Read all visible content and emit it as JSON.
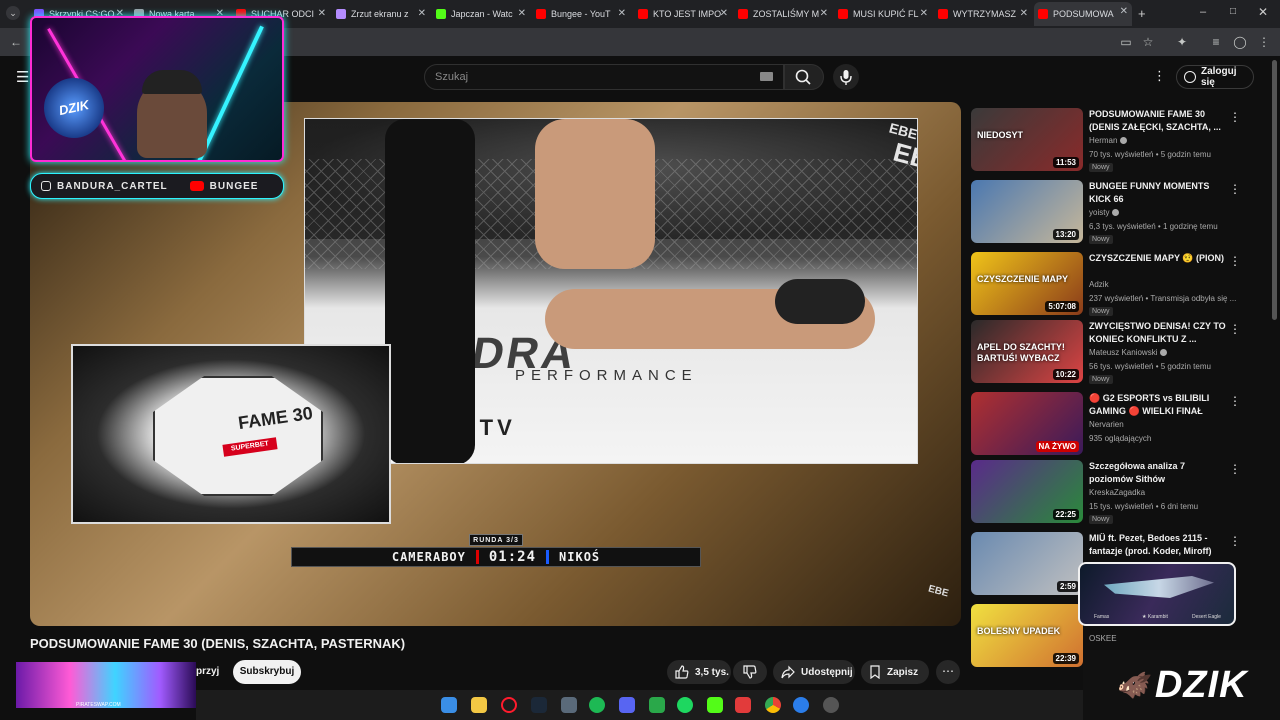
{
  "tabs": [
    {
      "label": "Skrzynki CS:GO",
      "color": "#7b4dff"
    },
    {
      "label": "Nowa karta",
      "color": "#9aa0a6"
    },
    {
      "label": "SUCHAR ODCI",
      "color": "#ff0000"
    },
    {
      "label": "Zrzut ekranu z",
      "color": "#b48cff"
    },
    {
      "label": "Japczan - Watc",
      "color": "#53fc18"
    },
    {
      "label": "Bungee - YouT",
      "color": "#ff0000"
    },
    {
      "label": "KTO JEST IMPO",
      "color": "#ff0000"
    },
    {
      "label": "ZOSTALIŚMY M",
      "color": "#ff0000"
    },
    {
      "label": "MUSI KUPIĆ FL",
      "color": "#ff0000"
    },
    {
      "label": "WYTRZYMASZ",
      "color": "#ff0000"
    },
    {
      "label": "PODSUMOWA",
      "color": "#ff0000"
    }
  ],
  "search": {
    "placeholder": "Szukaj"
  },
  "header": {
    "signin": "Zaloguj się"
  },
  "overlay": {
    "webcam_badge": "DZIK",
    "social_instagram": "BANDURA_CARTEL",
    "social_youtube": "BUNGEE"
  },
  "fight": {
    "mat_logo": "HYDRA",
    "mat_sub": "PERFORMANCE",
    "mat_url": "MMA.TV",
    "corner_logo": "EBE",
    "round": "RUNDA 3/3",
    "fighter_left": "CAMERABOY",
    "clock": "01:24",
    "fighter_right": "NIKOŚ",
    "overhead_brand": "FAME 30",
    "overhead_sponsor": "SUPERBET"
  },
  "video": {
    "title": "PODSUMOWANIE FAME 30 (DENIS, SZACHTA, PASTERNAK)",
    "channel_tail": "przyj",
    "subscribe": "Subskrybuj",
    "likes": "3,5 tys.",
    "share": "Udostępnij",
    "save": "Zapisz"
  },
  "recommendations": [
    {
      "title": "PODSUMOWANIE FAME 30 (DENIS ZAŁĘCKI, SZACHTA, ...",
      "channel": "Herman",
      "verified": true,
      "meta": "70 tys. wyświetleń • 5 godzin temu",
      "badge": "Nowy",
      "duration": "11:53",
      "thumb_text": "NIEDOSYT",
      "c1": "#3a3a3a",
      "c2": "#8a2a2a"
    },
    {
      "title": "BUNGEE FUNNY MOMENTS KICK 66",
      "channel": "yoisty",
      "verified": true,
      "meta": "6,3 tys. wyświetleń • 1 godzinę temu",
      "badge": "Nowy",
      "duration": "13:20",
      "thumb_text": "",
      "c1": "#4b78b0",
      "c2": "#c6b79a"
    },
    {
      "title": "CZYSZCZENIE MAPY 🤨 (PION)",
      "channel": "Adzik",
      "verified": false,
      "meta": "237 wyświetleń • Transmisja odbyła się ...",
      "badge": "Nowy",
      "duration": "5:07:08",
      "thumb_text": "CZYSZCZENIE MAPY",
      "c1": "#f0c419",
      "c2": "#8a3b1a"
    },
    {
      "title": "ZWYCIĘSTWO DENISA! CZY TO KONIEC KONFLIKTU Z ...",
      "channel": "Mateusz Kaniowski",
      "verified": true,
      "meta": "56 tys. wyświetleń • 5 godzin temu",
      "badge": "Nowy",
      "duration": "10:22",
      "thumb_text": "APEL DO SZACHTY! BARTUŚ! WYBACZ",
      "c1": "#2a2a2a",
      "c2": "#d44"
    },
    {
      "title": "🔴 G2 ESPORTS vs BILIBILI GAMING 🔴 WIELKI FINAŁ FIR...",
      "channel": "Nervarien",
      "verified": false,
      "meta": "935 oglądających",
      "badge": "",
      "duration": "NA ŻYWO",
      "thumb_text": "",
      "c1": "#b03030",
      "c2": "#3a1a5a"
    },
    {
      "title": "Szczegółowa analiza 7 poziomów Sithów",
      "channel": "KreskaZagadka",
      "verified": false,
      "meta": "15 tys. wyświetleń • 6 dni temu",
      "badge": "Nowy",
      "duration": "22:25",
      "thumb_text": "",
      "c1": "#5a2a8a",
      "c2": "#2a8a3a"
    },
    {
      "title": "MIÜ ft. Pezet, Bedoes 2115 - fantazje (prod. Koder, Miroff)",
      "channel": "",
      "verified": false,
      "meta": "",
      "badge": "",
      "duration": "2:59",
      "thumb_text": "",
      "c1": "#6a8ab0",
      "c2": "#c0c0c0"
    },
    {
      "title": "",
      "channel": "OSKEE",
      "verified": false,
      "meta": "",
      "badge": "",
      "duration": "22:39",
      "thumb_text": "BOLESNY UPADEK",
      "c1": "#f0e040",
      "c2": "#d07030"
    }
  ],
  "popup": {
    "left": "Famas",
    "mid": "★ Karambit",
    "right": "Desert Eagle"
  },
  "branding": {
    "logo": "DZIK"
  },
  "glitch_label": "PIRATESWAP.COM"
}
